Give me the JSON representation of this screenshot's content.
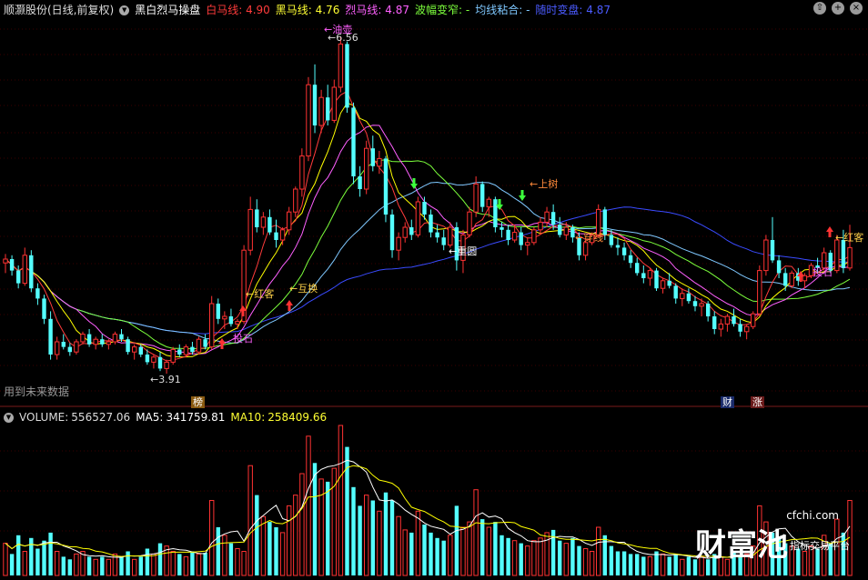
{
  "header": {
    "stock": "顺灏股份(日线,前复权)",
    "indicator": "黑白烈马操盘",
    "white_label": "白马线:",
    "white_value": "4.90",
    "black_label": "黑马线:",
    "black_value": "4.76",
    "lie_label": "烈马线:",
    "lie_value": "4.87",
    "narrow_label": "波幅变窄:",
    "narrow_value": "-",
    "glue_label": "均线粘合:",
    "glue_value": "-",
    "sudden_label": "随时变盘:",
    "sudden_value": "4.87"
  },
  "volume_header": {
    "label": "VOLUME:",
    "value": "556527.06",
    "ma5_label": "MA5:",
    "ma5_value": "341759.81",
    "ma10_label": "MA10:",
    "ma10_value": "258409.66"
  },
  "controls": {
    "up": "⇧",
    "plus": "+",
    "close": "×"
  },
  "future_note": "用到未来数据",
  "badges": {
    "b1": "榜",
    "b2": "财",
    "b3": "涨"
  },
  "watermark": {
    "site": "cfchi.com",
    "name": "财富池",
    "sub": "指标交易平台"
  },
  "colors": {
    "up": "#ff3232",
    "down": "#54ffff",
    "white_line": "#ff3b3b",
    "yellow_line": "#ffff00",
    "magenta_line": "#ff60ff",
    "green_line": "#7cff3c",
    "lightblue_line": "#7fc8ff",
    "blue_line": "#3a4bff",
    "vol_white": "#ffffff",
    "vol_yellow": "#ffff00"
  },
  "chart_data": {
    "type": "candlestick",
    "price_ticks": [],
    "y_top_label": "6.56",
    "y_bottom_label": "3.91",
    "annotations": [
      {
        "text": "←油壶",
        "color": "#ff60ff"
      },
      {
        "text": "←6.56",
        "color": "#dddddd"
      },
      {
        "text": "←3.91",
        "color": "#dddddd"
      },
      {
        "text": "←红客",
        "color": "#ffd24a"
      },
      {
        "text": "←互换",
        "color": "#ffd24a"
      },
      {
        "text": "投石",
        "color": "#ff60ff"
      },
      {
        "text": "←重圆",
        "color": "#ffffff"
      },
      {
        "text": "←上树",
        "color": "#ff8a3a"
      },
      {
        "text": "←穿线",
        "color": "#ff8a3a"
      },
      {
        "text": "投石",
        "color": "#ff60ff"
      },
      {
        "text": "←红客",
        "color": "#ffd24a"
      }
    ],
    "candles": [
      [
        4.78,
        4.85,
        4.7,
        4.81
      ],
      [
        4.81,
        4.84,
        4.68,
        4.72
      ],
      [
        4.72,
        4.76,
        4.58,
        4.62
      ],
      [
        4.62,
        4.9,
        4.6,
        4.84
      ],
      [
        4.84,
        4.88,
        4.55,
        4.58
      ],
      [
        4.58,
        4.62,
        4.45,
        4.5
      ],
      [
        4.5,
        4.53,
        4.3,
        4.34
      ],
      [
        4.34,
        4.4,
        4.02,
        4.06
      ],
      [
        4.06,
        4.2,
        4.02,
        4.16
      ],
      [
        4.16,
        4.22,
        4.1,
        4.12
      ],
      [
        4.12,
        4.15,
        4.05,
        4.08
      ],
      [
        4.08,
        4.18,
        4.06,
        4.16
      ],
      [
        4.16,
        4.24,
        4.14,
        4.22
      ],
      [
        4.22,
        4.26,
        4.12,
        4.14
      ],
      [
        4.14,
        4.2,
        4.1,
        4.18
      ],
      [
        4.18,
        4.22,
        4.12,
        4.14
      ],
      [
        4.14,
        4.18,
        4.1,
        4.16
      ],
      [
        4.16,
        4.24,
        4.14,
        4.22
      ],
      [
        4.22,
        4.26,
        4.16,
        4.18
      ],
      [
        4.18,
        4.2,
        4.06,
        4.08
      ],
      [
        4.08,
        4.14,
        4.02,
        4.12
      ],
      [
        4.12,
        4.14,
        4.04,
        4.06
      ],
      [
        4.06,
        4.1,
        3.98,
        4.0
      ],
      [
        4.0,
        4.06,
        3.95,
        4.04
      ],
      [
        4.04,
        4.08,
        3.93,
        3.95
      ],
      [
        3.95,
        4.02,
        3.91,
        4.0
      ],
      [
        4.0,
        4.12,
        3.98,
        4.1
      ],
      [
        4.1,
        4.14,
        4.04,
        4.06
      ],
      [
        4.06,
        4.14,
        4.04,
        4.12
      ],
      [
        4.12,
        4.16,
        4.06,
        4.08
      ],
      [
        4.08,
        4.2,
        4.06,
        4.18
      ],
      [
        4.18,
        4.22,
        4.1,
        4.12
      ],
      [
        4.12,
        4.52,
        4.1,
        4.46
      ],
      [
        4.46,
        4.5,
        4.3,
        4.34
      ],
      [
        4.34,
        4.4,
        4.26,
        4.36
      ],
      [
        4.36,
        4.42,
        4.28,
        4.3
      ],
      [
        4.3,
        4.34,
        4.26,
        4.32
      ],
      [
        4.32,
        4.92,
        4.3,
        4.88
      ],
      [
        4.88,
        5.3,
        4.84,
        5.2
      ],
      [
        5.2,
        5.28,
        5.02,
        5.06
      ],
      [
        5.06,
        5.18,
        5.0,
        5.14
      ],
      [
        5.14,
        5.2,
        5.0,
        5.02
      ],
      [
        5.02,
        5.12,
        4.9,
        4.96
      ],
      [
        4.96,
        5.06,
        4.92,
        5.04
      ],
      [
        5.04,
        5.22,
        5.0,
        5.18
      ],
      [
        5.18,
        5.38,
        5.14,
        5.36
      ],
      [
        5.36,
        5.68,
        5.3,
        5.62
      ],
      [
        5.62,
        6.24,
        5.58,
        6.18
      ],
      [
        6.18,
        6.34,
        5.8,
        5.86
      ],
      [
        5.86,
        6.14,
        5.8,
        6.08
      ],
      [
        6.08,
        6.18,
        5.86,
        5.9
      ],
      [
        5.9,
        6.22,
        5.88,
        6.16
      ],
      [
        6.16,
        6.56,
        6.12,
        6.5
      ],
      [
        6.5,
        6.52,
        5.96,
        6.0
      ],
      [
        6.0,
        6.04,
        5.4,
        5.46
      ],
      [
        5.46,
        5.54,
        5.3,
        5.36
      ],
      [
        5.36,
        5.74,
        5.32,
        5.68
      ],
      [
        5.68,
        5.78,
        5.5,
        5.54
      ],
      [
        5.54,
        5.66,
        5.48,
        5.6
      ],
      [
        5.6,
        5.62,
        5.1,
        5.16
      ],
      [
        5.16,
        5.2,
        4.82,
        4.88
      ],
      [
        4.88,
        5.02,
        4.8,
        4.98
      ],
      [
        4.98,
        5.1,
        4.94,
        5.06
      ],
      [
        5.06,
        5.12,
        4.96,
        5.0
      ],
      [
        5.0,
        5.3,
        4.98,
        5.26
      ],
      [
        5.26,
        5.3,
        5.12,
        5.16
      ],
      [
        5.16,
        5.2,
        4.98,
        5.02
      ],
      [
        5.02,
        5.08,
        4.94,
        4.98
      ],
      [
        4.98,
        5.04,
        4.88,
        4.92
      ],
      [
        4.92,
        5.1,
        4.9,
        5.06
      ],
      [
        5.06,
        5.1,
        4.72,
        4.8
      ],
      [
        4.8,
        5.04,
        4.7,
        5.0
      ],
      [
        5.0,
        5.22,
        4.98,
        5.18
      ],
      [
        5.18,
        5.46,
        5.14,
        5.4
      ],
      [
        5.4,
        5.42,
        5.18,
        5.22
      ],
      [
        5.22,
        5.3,
        5.14,
        5.28
      ],
      [
        5.28,
        5.3,
        5.02,
        5.06
      ],
      [
        5.06,
        5.1,
        4.98,
        5.04
      ],
      [
        5.04,
        5.08,
        4.92,
        4.96
      ],
      [
        4.96,
        5.08,
        4.94,
        5.02
      ],
      [
        5.02,
        5.06,
        4.88,
        4.92
      ],
      [
        4.92,
        4.98,
        4.84,
        4.94
      ],
      [
        4.94,
        5.06,
        4.92,
        5.04
      ],
      [
        5.04,
        5.14,
        5.0,
        5.1
      ],
      [
        5.1,
        5.22,
        5.06,
        5.18
      ],
      [
        5.18,
        5.24,
        5.04,
        5.08
      ],
      [
        5.08,
        5.14,
        4.98,
        5.0
      ],
      [
        5.0,
        5.1,
        4.96,
        5.06
      ],
      [
        5.06,
        5.08,
        4.94,
        4.98
      ],
      [
        4.98,
        5.02,
        4.8,
        4.84
      ],
      [
        4.84,
        4.96,
        4.8,
        4.94
      ],
      [
        4.94,
        5.02,
        4.92,
        5.0
      ],
      [
        5.0,
        5.24,
        4.98,
        5.2
      ],
      [
        5.2,
        5.22,
        4.96,
        5.0
      ],
      [
        5.0,
        5.04,
        4.9,
        4.92
      ],
      [
        4.92,
        4.98,
        4.84,
        4.9
      ],
      [
        4.9,
        4.94,
        4.8,
        4.84
      ],
      [
        4.84,
        4.88,
        4.74,
        4.78
      ],
      [
        4.78,
        4.82,
        4.68,
        4.7
      ],
      [
        4.7,
        4.76,
        4.62,
        4.66
      ],
      [
        4.66,
        4.74,
        4.6,
        4.72
      ],
      [
        4.72,
        4.74,
        4.56,
        4.58
      ],
      [
        4.58,
        4.66,
        4.54,
        4.64
      ],
      [
        4.64,
        4.7,
        4.58,
        4.6
      ],
      [
        4.6,
        4.62,
        4.46,
        4.5
      ],
      [
        4.5,
        4.58,
        4.44,
        4.54
      ],
      [
        4.54,
        4.58,
        4.46,
        4.48
      ],
      [
        4.48,
        4.52,
        4.4,
        4.44
      ],
      [
        4.44,
        4.5,
        4.36,
        4.46
      ],
      [
        4.46,
        4.48,
        4.32,
        4.36
      ],
      [
        4.36,
        4.4,
        4.22,
        4.26
      ],
      [
        4.26,
        4.34,
        4.2,
        4.3
      ],
      [
        4.3,
        4.38,
        4.24,
        4.36
      ],
      [
        4.36,
        4.42,
        4.28,
        4.3
      ],
      [
        4.3,
        4.34,
        4.2,
        4.24
      ],
      [
        4.24,
        4.3,
        4.18,
        4.28
      ],
      [
        4.28,
        4.4,
        4.26,
        4.38
      ],
      [
        4.38,
        4.76,
        4.36,
        4.72
      ],
      [
        4.72,
        5.0,
        4.68,
        4.96
      ],
      [
        4.96,
        5.14,
        4.78,
        4.8
      ],
      [
        4.8,
        4.84,
        4.66,
        4.7
      ],
      [
        4.7,
        4.74,
        4.56,
        4.6
      ],
      [
        4.6,
        4.72,
        4.58,
        4.7
      ],
      [
        4.7,
        4.74,
        4.6,
        4.64
      ],
      [
        4.64,
        4.7,
        4.58,
        4.68
      ],
      [
        4.68,
        4.78,
        4.66,
        4.76
      ],
      [
        4.76,
        4.82,
        4.7,
        4.74
      ],
      [
        4.74,
        4.9,
        4.72,
        4.86
      ],
      [
        4.86,
        4.88,
        4.7,
        4.72
      ],
      [
        4.72,
        5.0,
        4.7,
        4.96
      ],
      [
        4.96,
        5.04,
        4.7,
        4.74
      ],
      [
        4.74,
        5.08,
        4.72,
        4.9
      ]
    ],
    "volume": [
      120,
      80,
      150,
      90,
      140,
      100,
      130,
      160,
      90,
      70,
      60,
      80,
      90,
      70,
      60,
      70,
      60,
      80,
      70,
      90,
      60,
      70,
      100,
      80,
      120,
      110,
      90,
      80,
      70,
      90,
      80,
      85,
      280,
      180,
      150,
      120,
      100,
      90,
      410,
      300,
      220,
      200,
      180,
      160,
      260,
      300,
      380,
      520,
      420,
      360,
      350,
      400,
      560,
      480,
      330,
      260,
      300,
      280,
      240,
      310,
      280,
      220,
      170,
      160,
      240,
      190,
      160,
      140,
      130,
      150,
      260,
      180,
      200,
      320,
      210,
      180,
      200,
      150,
      140,
      130,
      120,
      110,
      130,
      140,
      160,
      170,
      130,
      120,
      140,
      110,
      100,
      90,
      180,
      150,
      110,
      90,
      90,
      80,
      80,
      70,
      70,
      90,
      80,
      70,
      80,
      60,
      70,
      60,
      70,
      60,
      80,
      70,
      60,
      90,
      70,
      80,
      110,
      260,
      200,
      160,
      140,
      120,
      110,
      100,
      90,
      110,
      100,
      150,
      120,
      210,
      160,
      280
    ]
  }
}
